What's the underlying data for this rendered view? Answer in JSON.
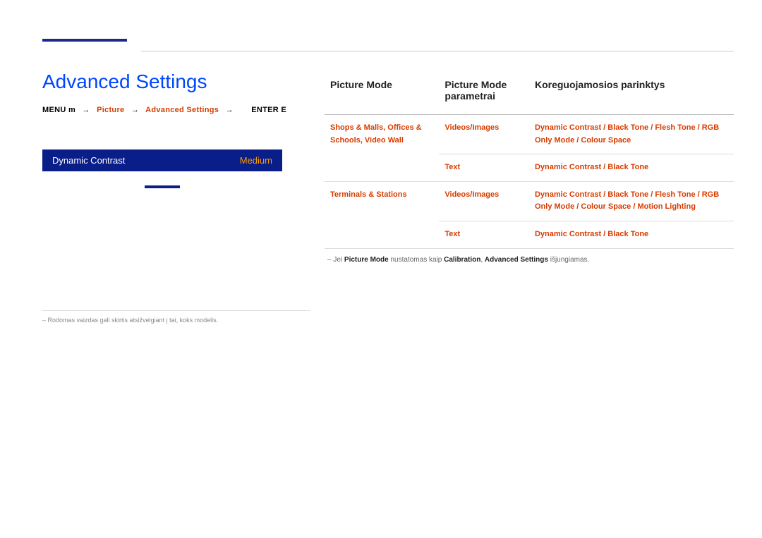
{
  "header": {
    "title": "Advanced Settings"
  },
  "breadcrumb": {
    "menu": "MENU m",
    "s1": "Picture",
    "s2": "Advanced Settings",
    "enter": "ENTER E"
  },
  "preview": {
    "label": "Dynamic Contrast",
    "value": "Medium"
  },
  "table": {
    "h1": "Picture Mode",
    "h2": "Picture Mode parametrai",
    "h3": "Koreguojamosios parinktys",
    "rows": [
      {
        "c1": "Shops & Malls,   Offices & Schools, Video Wall",
        "c2": "Videos/Images",
        "c3": "Dynamic Contrast / Black Tone / Flesh Tone / RGB Only Mode / Colour Space"
      },
      {
        "c1": "",
        "c2": "Text",
        "c3": "Dynamic Contrast / Black Tone"
      },
      {
        "c1": "Terminals & Stations",
        "c2": "Videos/Images",
        "c3": "Dynamic Contrast / Black Tone / Flesh Tone / RGB Only Mode / Colour Space / Motion Lighting"
      },
      {
        "c1": "",
        "c2": "Text",
        "c3": "Dynamic Contrast / Black Tone"
      }
    ]
  },
  "footnote": {
    "prefix": "Jei",
    "b1": "Picture Mode",
    "mid": "nustatomas kaip",
    "b2": "Calibration",
    "sep": ",",
    "b3": "Advanced Settings",
    "suffix": "išjungiamas."
  },
  "bottom_note": "Rodomas vaizdas gali skirtis atsižvelgiant į tai, koks modelis."
}
